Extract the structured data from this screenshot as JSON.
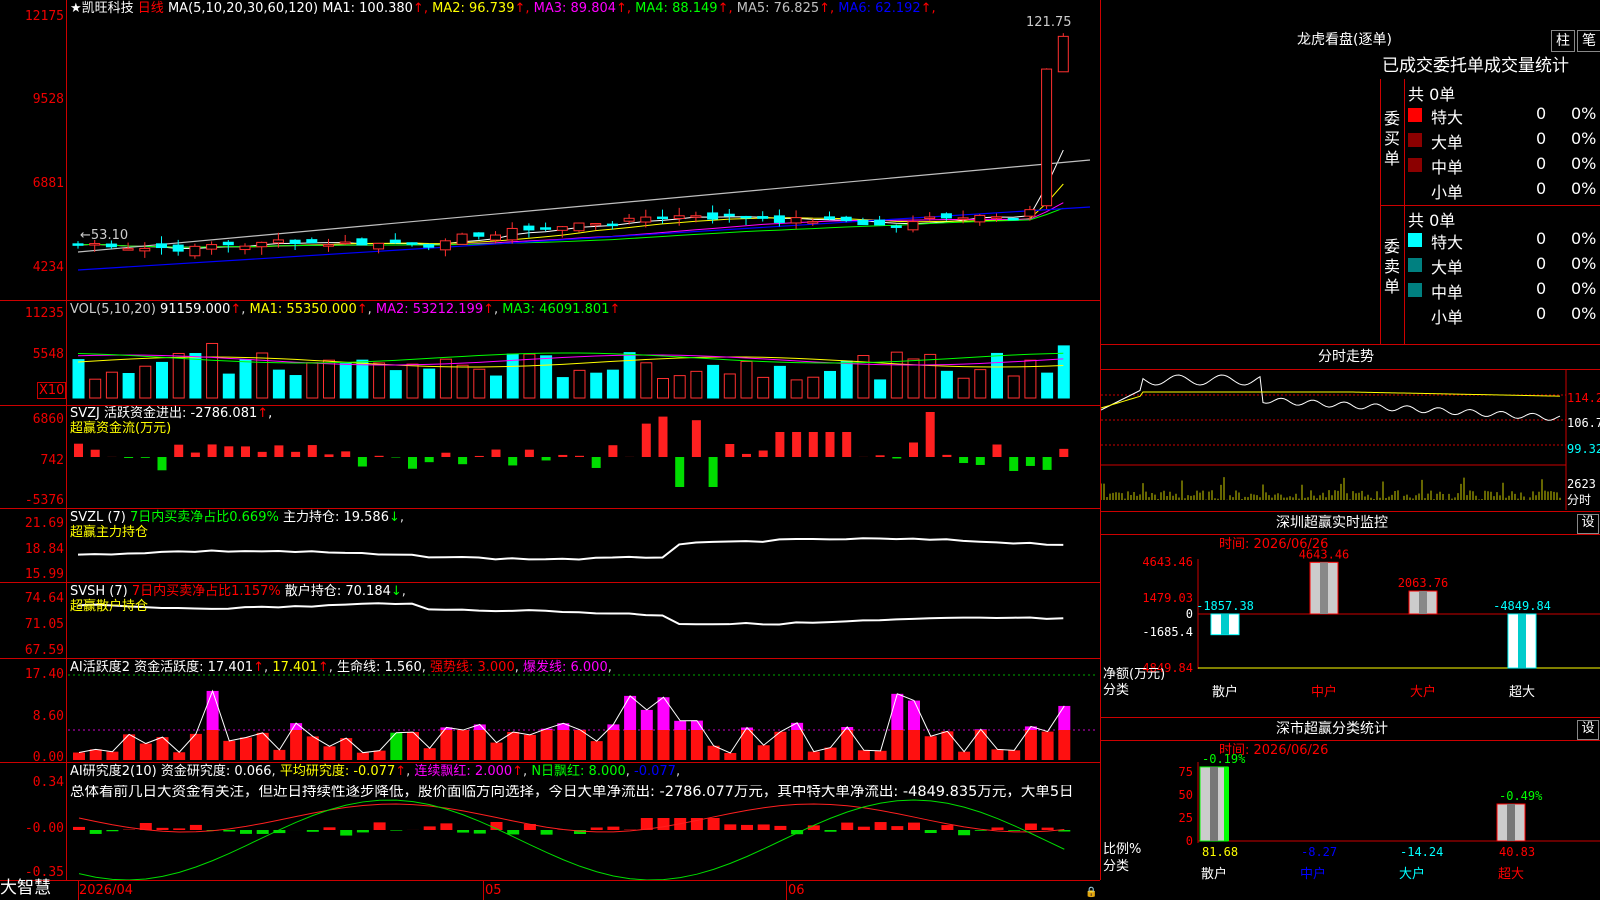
{
  "brand": "大智慧",
  "stock": {
    "name": "★凯旺科技",
    "period": "日线"
  },
  "main": {
    "ma_label": "MA(5,10,20,30,60,120)",
    "ma": [
      {
        "t": "MA1: 100.380",
        "c": "#ffffff"
      },
      {
        "t": "MA2: 96.739",
        "c": "#ffff00"
      },
      {
        "t": "MA3: 89.804",
        "c": "#ff00ff"
      },
      {
        "t": "MA4: 88.149",
        "c": "#00ff00"
      },
      {
        "t": "MA5: 76.825",
        "c": "#c0c0c0"
      },
      {
        "t": "MA6: 62.192",
        "c": "#0000ff"
      }
    ],
    "ticks": [
      "12175",
      "9528",
      "6881",
      "4234"
    ],
    "high": "121.75",
    "low": "53.10"
  },
  "vol": {
    "title": "VOL(5,10,20)",
    "v": "91159.000",
    "ma1": "MA1: 55350.000",
    "ma2": "MA2: 53212.199",
    "ma3": "MA3: 46091.801",
    "ticks": [
      "11235",
      "5548"
    ],
    "unit": "X10"
  },
  "svzj": {
    "t1": "SVZJ  活跃资金进出: -2786.081",
    "t2": "超赢资金流(万元)",
    "ticks": [
      "6860",
      "742",
      "-5376"
    ]
  },
  "svzl": {
    "t1": "SVZL (7)",
    "t2": "7日内买卖净占比0.669%",
    "t3": "主力持仓: 19.586",
    "t4": "超赢主力持仓",
    "ticks": [
      "21.69",
      "18.84",
      "15.99"
    ]
  },
  "svsh": {
    "t1": "SVSH (7)",
    "t2": "7日内买卖净占比1.157%",
    "t3": "散户持仓: 70.184",
    "t4": "超赢散户持仓",
    "ticks": [
      "74.64",
      "71.05",
      "67.59"
    ]
  },
  "ai1": {
    "t1": "AI活跃度2 资金活跃度: 17.401",
    "t2": "17.401",
    "t3": "生命线: 1.560",
    "t4": "强势线: 3.000",
    "t5": "爆发线: 6.000",
    "ticks": [
      "17.40",
      "8.60",
      "0.00"
    ]
  },
  "ai2": {
    "t1": "AI研究度2(10) 资金研究度: 0.066",
    "t2": "平均研究度: -0.077",
    "t3": "连续飘红: 2.000",
    "t4": "N日飘红: 8.000",
    "t5": "-0.077",
    "comment": "总体看前几日大资金有关注，但近日持续性逐步降低，股价面临方向选择，今日大单净流出: -2786.077万元，其中特大单净流出: -4849.835万元，大单5日",
    "ticks": [
      "0.34",
      "-0.00",
      "-0.35"
    ]
  },
  "dates": [
    "2026/04",
    "05",
    "06"
  ],
  "right": {
    "lhkp": "龙虎看盘(逐单)",
    "btn1": "柱",
    "btn2": "笔",
    "tabs": "已成交委托单成交量统计",
    "buy": {
      "side": "委买单",
      "total": "共 0单",
      "rows": [
        {
          "name": "特大",
          "n": "0",
          "p": "0%",
          "c": "#ff0000"
        },
        {
          "name": "大单",
          "n": "0",
          "p": "0%",
          "c": "#8b0000"
        },
        {
          "name": "中单",
          "n": "0",
          "p": "0%",
          "c": "#8b0000"
        },
        {
          "name": "小单",
          "n": "0",
          "p": "0%",
          "c": "#000"
        }
      ]
    },
    "sell": {
      "side": "委卖单",
      "total": "共 0单",
      "rows": [
        {
          "name": "特大",
          "n": "0",
          "p": "0%",
          "c": "#00ffff"
        },
        {
          "name": "大单",
          "n": "0",
          "p": "0%",
          "c": "#008080"
        },
        {
          "name": "中单",
          "n": "0",
          "p": "0%",
          "c": "#008080"
        },
        {
          "name": "小单",
          "n": "0",
          "p": "0%",
          "c": "#000"
        }
      ]
    },
    "fs": {
      "title": "分时走势",
      "p1": "114.2",
      "p2": "106.7",
      "p3": "99.32",
      "v": "2623",
      "vlab": "分时"
    },
    "sz": {
      "title": "深圳超赢实时监控",
      "set": "设",
      "time": "时间: 2026/06/26",
      "ticks": [
        "4643.46",
        "1479.03",
        "0",
        "-1685.4",
        "-4849.84"
      ],
      "vals": [
        {
          "n": "散户",
          "v": "-1857.38"
        },
        {
          "n": "中户",
          "v": "4643.46"
        },
        {
          "n": "大户",
          "v": "2063.76"
        },
        {
          "n": "超大",
          "v": "-4849.84"
        }
      ],
      "ylab": "净额(万元)",
      "xlab": "分类"
    },
    "ss": {
      "title": "深市超赢分类统计",
      "set": "设",
      "time": "时间: 2026/06/26",
      "ticks": [
        "75",
        "50",
        "25",
        "0"
      ],
      "vals": [
        {
          "n": "散户",
          "v": "81.68",
          "d": "-0.19%"
        },
        {
          "n": "中户",
          "v": "-8.27",
          "d": ""
        },
        {
          "n": "大户",
          "v": "-14.24",
          "d": ""
        },
        {
          "n": "超大",
          "v": "40.83",
          "d": "-0.49%"
        }
      ],
      "ylab": "比例%",
      "xlab": "分类"
    }
  }
}
